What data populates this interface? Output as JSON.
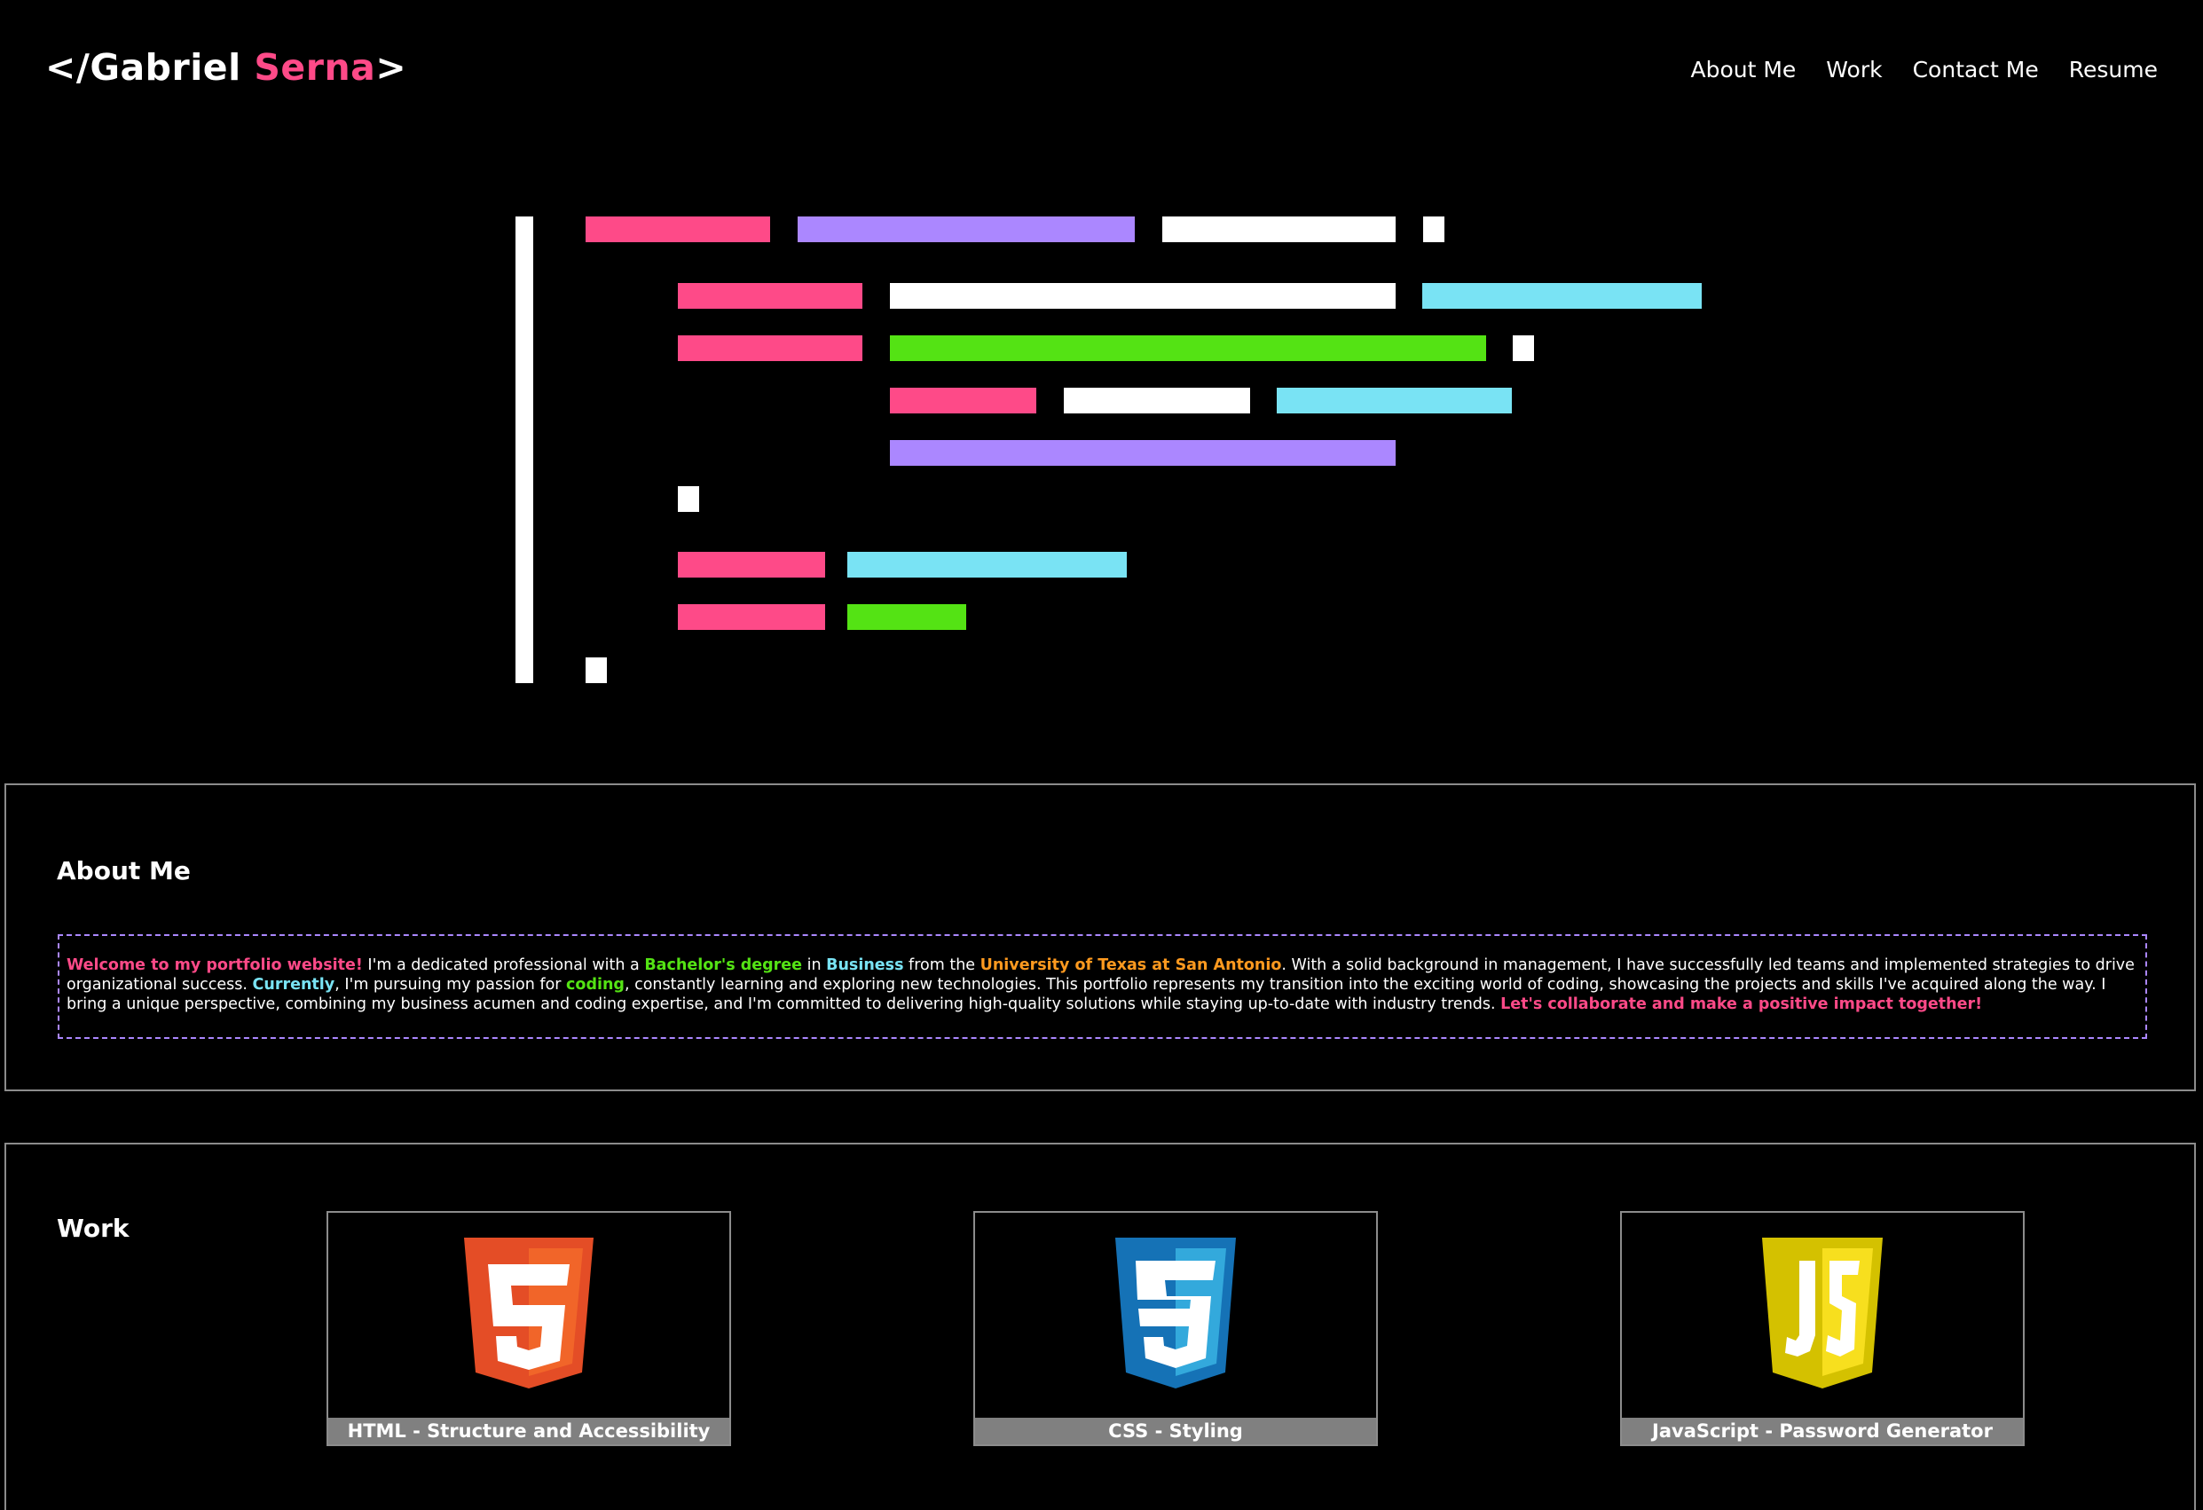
{
  "header": {
    "logo_prefix": "</",
    "logo_first": "Gabriel ",
    "logo_last": "Serna",
    "logo_suffix": ">",
    "nav": [
      {
        "label": "About Me"
      },
      {
        "label": "Work"
      },
      {
        "label": "Contact Me"
      },
      {
        "label": "Resume"
      }
    ]
  },
  "colors": {
    "pink": "#fe4a88",
    "purple": "#ab87ff",
    "white": "#ffffff",
    "cyan": "#79e3f4",
    "green": "#54e314",
    "orange": "#ff9a1f",
    "background": "#000000"
  },
  "hero": {
    "image": "code-illustration"
  },
  "about": {
    "title": "About Me",
    "p_welcome": "Welcome to my portfolio website!",
    "p_t1": " I'm a dedicated professional with a ",
    "p_degree": "Bachelor's degree",
    "p_t2": " in ",
    "p_business": "Business",
    "p_t3": " from the ",
    "p_university": "University of Texas at San Antonio",
    "p_t4": ". With a solid background in management, I have successfully led teams and implemented strategies to drive organizational success. ",
    "p_currently": "Currently",
    "p_t5": ", I'm pursuing my passion for ",
    "p_coding": "coding",
    "p_t6": ", constantly learning and exploring new technologies. This portfolio represents my transition into the exciting world of coding, showcasing the projects and skills I've acquired along the way. I bring a unique perspective, combining my business acumen and coding expertise, and I'm committed to delivering high-quality solutions while staying up-to-date with industry trends. ",
    "p_collab": "Let's collaborate and make a positive impact together!"
  },
  "work": {
    "title": "Work",
    "projects": [
      {
        "caption": "HTML - Structure and Accessibility",
        "icon": "html5-logo-icon"
      },
      {
        "caption": "CSS - Styling",
        "icon": "css3-logo-icon"
      },
      {
        "caption": "JavaScript - Password Generator",
        "icon": "js-logo-icon"
      }
    ]
  }
}
